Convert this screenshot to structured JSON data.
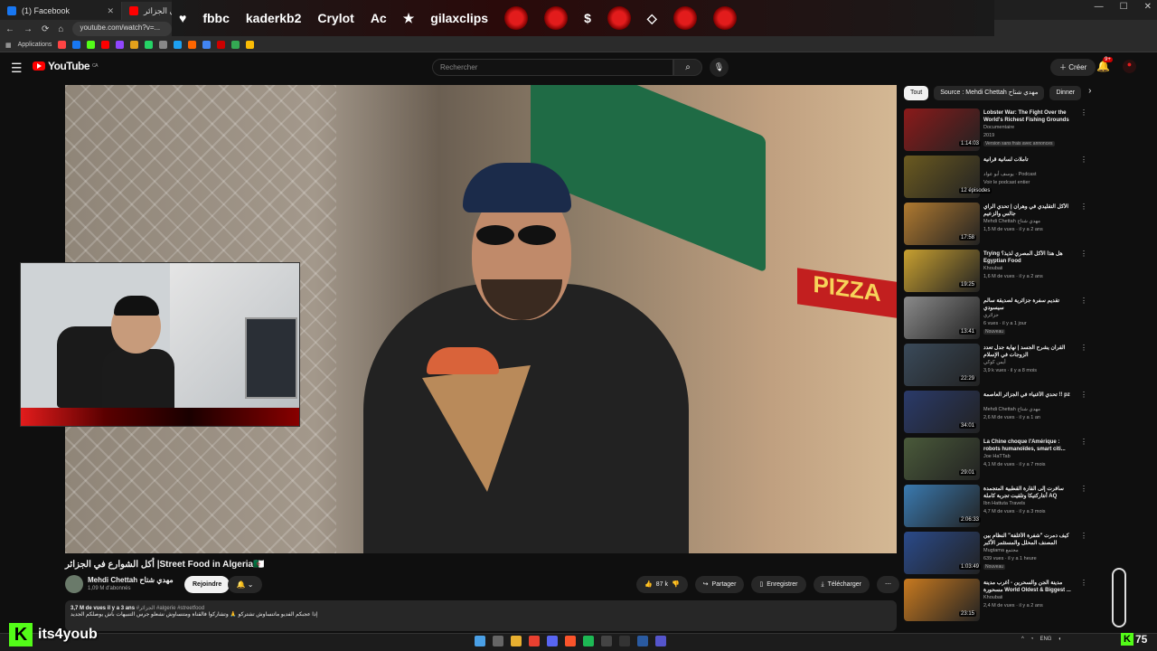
{
  "tabs": [
    {
      "label": "(1) Facebook",
      "color": "#1877f2"
    },
    {
      "label": "أكل الشوارع في الجزائر",
      "color": "#ff0000"
    }
  ],
  "address": "youtube.com/watch?v=...",
  "bookmarks_label": "Applications",
  "overlay": {
    "items": [
      "fbbc",
      "kaderkb2",
      "Crylot",
      "Ac",
      "gilaxclips"
    ]
  },
  "youtube": {
    "logo": "YouTube",
    "country": "CA",
    "search_placeholder": "Rechercher",
    "create": "Créer",
    "notif_badge": "9+"
  },
  "video": {
    "title": "أكل الشوارع في الجزائر |Street Food in Algeria🇩🇿",
    "channel": "Mehdi Chettah مهدي شتاح",
    "subs": "1,09 M d'abonnés",
    "join": "Rejoindre",
    "likes": "87 k",
    "share": "Partager",
    "save": "Enregistrer",
    "download": "Télécharger",
    "views_date": "3,7 M de vues  il y a 3 ans",
    "tags": "#الجزائر #algerie #streetfood",
    "desc": "إذا عجبكم الفديو ماتنساوش تشتركو 🙏 وتشاركوا فالقناة ومتنساوش نشعلو جرس التنبيهات باش يوصلكم الجديد"
  },
  "chips": [
    "Tout",
    "Source : Mehdi Chettah مهدي شتاح",
    "Dinner"
  ],
  "recs": [
    {
      "title": "Lobster War: The Fight Over the World's Richest Fishing Grounds",
      "channel": "Documentaire",
      "views": "2019",
      "badge": "Version sans frais avec annonces",
      "dur": "1:14:03",
      "thumb": "#8b1a1a"
    },
    {
      "title": "تأملات لسانية قرآنية",
      "channel": "يوسف أبو عواد · Podcast",
      "views": "Voir le podcast entier",
      "badge": "",
      "dur": "12 épisodes",
      "thumb": "#6b5a20"
    },
    {
      "title": "الأكل التقليدي في وهران | تحدي الراي جالس والزعيم",
      "channel": "Mehdi Chettah مهدي شتاح",
      "views": "1,5 M de vues · il y a 2 ans",
      "badge": "",
      "dur": "17:58",
      "thumb": "#b07a30"
    },
    {
      "title": "Trying هل هذا الأكل المصري لذيذ؟ Egyptian Food",
      "channel": "Khoubaii",
      "views": "1,6 M de vues · il y a 2 ans",
      "badge": "",
      "dur": "19:25",
      "thumb": "#c8a030"
    },
    {
      "title": "تقديم سفرة جزائرية لصديقة سالم سيسودي",
      "channel": "جزائري",
      "views": "6 vues · il y a 1 jour",
      "badge": "Nouveau",
      "dur": "13:41",
      "thumb": "#8a8a8a"
    },
    {
      "title": "القرآن يشرح الجسد | نهاية جدل تعدد الزوجات في الإسلام",
      "channel": "أيمن كوكي",
      "views": "3,9 k vues · il y a 8 mois",
      "badge": "",
      "dur": "22:29",
      "thumb": "#3a4a5a"
    },
    {
      "title": "تحدي الأغنياء في الجزائر العاصمة !! pz",
      "channel": "Mehdi Chettah مهدي شتاح",
      "views": "2,6 M de vues · il y a 1 an",
      "badge": "",
      "dur": "34:01",
      "thumb": "#2a3a6a"
    },
    {
      "title": "La Chine choque l'Amérique : robots humanoïdes, smart citi...",
      "channel": "Joe HaTTab",
      "views": "4,1 M de vues · il y a 7 mois",
      "badge": "",
      "dur": "29:01",
      "thumb": "#4a5a3a"
    },
    {
      "title": "سافرت إلى القارة القطبية المتجمدة أنتاركتيكا وتلقيت تجربة كاملة AQ",
      "channel": "Ibn Hattuta Travels",
      "views": "4,7 M de vues · il y a 3 mois",
      "badge": "",
      "dur": "2:06:33",
      "thumb": "#3a7ab0"
    },
    {
      "title": "كيف دمرت \"شفرة الأغلفة\" النظام بين المصنف المحلل والمستثمر الأكبر",
      "channel": "Mugtama مجتمع",
      "views": "639 vues · il y a 1 heure",
      "badge": "Nouveau",
      "dur": "1:03:49",
      "thumb": "#2a4a8a"
    },
    {
      "title": "مدينة الجن والسحرين - أغرب مدينة مسحورة World Oldest & Biggest ...",
      "channel": "Khoubaii",
      "views": "2,4 M de vues · il y a 2 ans",
      "badge": "",
      "dur": "23:15",
      "thumb": "#c87a20"
    }
  ],
  "kick": {
    "name": "its4youb",
    "count": "75"
  }
}
